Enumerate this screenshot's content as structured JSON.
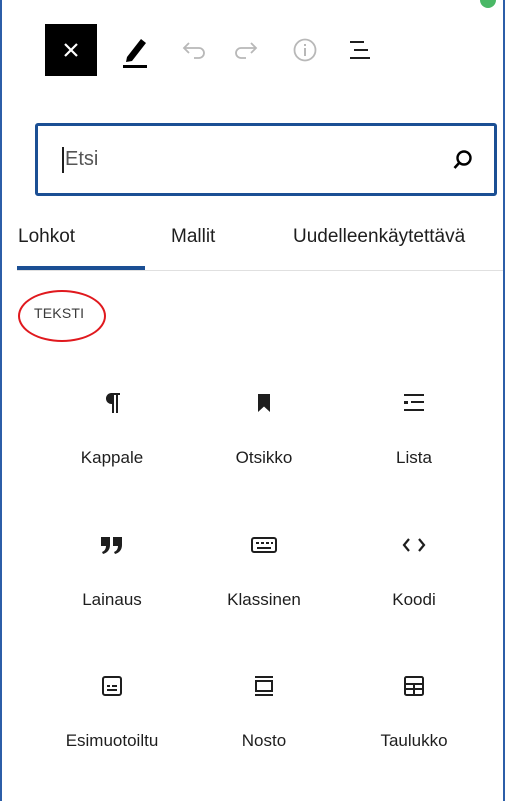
{
  "toolbar": {
    "close_icon": "close-icon",
    "tools_icon": "pencil-icon",
    "undo_icon": "undo-icon",
    "redo_icon": "redo-icon",
    "info_icon": "info-icon",
    "outline_icon": "list-view-icon"
  },
  "search": {
    "placeholder": "Etsi",
    "value": "",
    "icon": "search-icon"
  },
  "tabs": [
    {
      "label": "Lohkot",
      "selected": true
    },
    {
      "label": "Mallit",
      "selected": false
    },
    {
      "label": "Uudelleenkäytettävä",
      "selected": false
    }
  ],
  "category": {
    "label": "TEKSTI",
    "highlight_color": "#e0191e"
  },
  "blocks": [
    {
      "label": "Kappale",
      "icon": "paragraph-icon"
    },
    {
      "label": "Otsikko",
      "icon": "bookmark-icon"
    },
    {
      "label": "Lista",
      "icon": "list-icon"
    },
    {
      "label": "Lainaus",
      "icon": "quote-icon"
    },
    {
      "label": "Klassinen",
      "icon": "keyboard-icon"
    },
    {
      "label": "Koodi",
      "icon": "code-icon"
    },
    {
      "label": "Esimuotoiltu",
      "icon": "preformatted-icon"
    },
    {
      "label": "Nosto",
      "icon": "pullquote-icon"
    },
    {
      "label": "Taulukko",
      "icon": "table-icon"
    }
  ],
  "colors": {
    "accent": "#1b4f94",
    "frame": "#2c5ea8",
    "status_dot": "#4ab866"
  }
}
